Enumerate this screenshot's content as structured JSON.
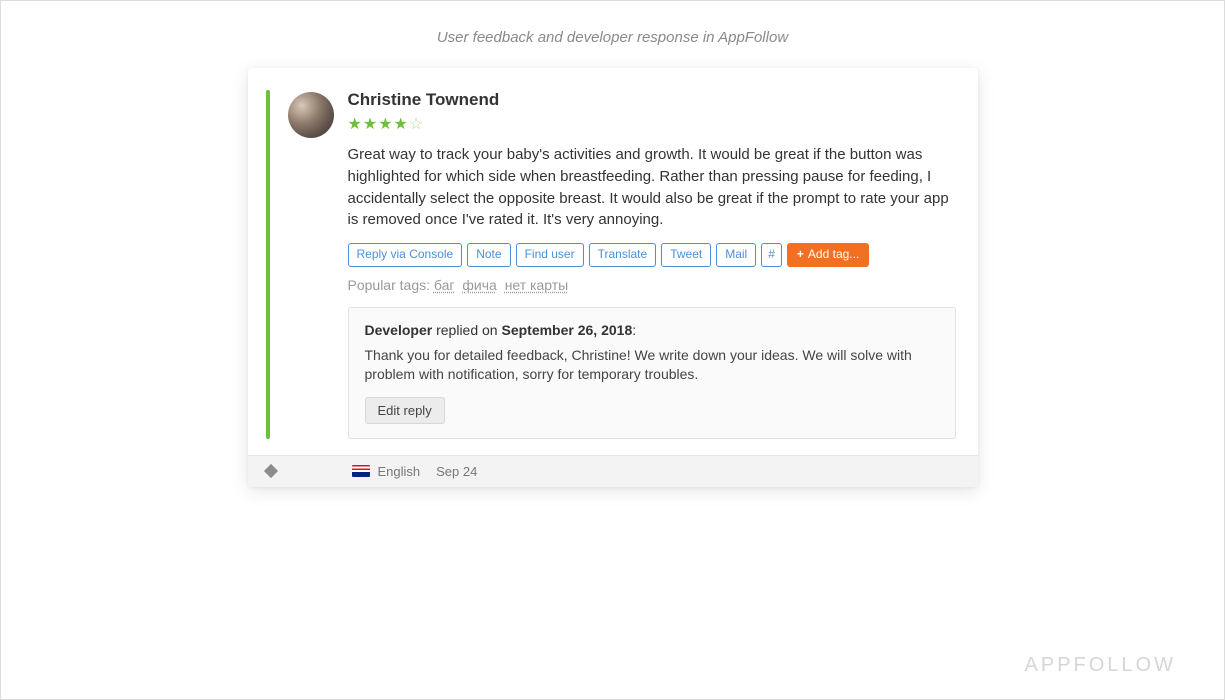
{
  "caption": "User feedback and developer response in AppFollow",
  "review": {
    "author": "Christine Townend",
    "rating": 4,
    "max_rating": 5,
    "text": "Great way to track your baby's activities and growth. It would be great if the button was highlighted for which side when breastfeeding. Rather than pressing pause for feeding, I accidentally select the opposite breast. It would also be great if the prompt to rate your app is removed once I've rated it. It's very annoying."
  },
  "actions": {
    "reply_console": "Reply via Console",
    "note": "Note",
    "find_user": "Find user",
    "translate": "Translate",
    "tweet": "Tweet",
    "mail": "Mail",
    "hash": "#",
    "add_tag": "Add tag..."
  },
  "tags": {
    "label": "Popular tags:",
    "items": [
      "баг",
      "фича",
      "нет карты"
    ]
  },
  "developer_reply": {
    "role": "Developer",
    "verb": "replied on",
    "date": "September 26, 2018",
    "colon": ":",
    "text": "Thank you for detailed feedback, Christine! We write down your ideas. We will solve with problem with notification, sorry for temporary troubles.",
    "edit_label": "Edit reply"
  },
  "footer": {
    "language": "English",
    "date": "Sep 24"
  },
  "watermark": "APPFOLLOW"
}
